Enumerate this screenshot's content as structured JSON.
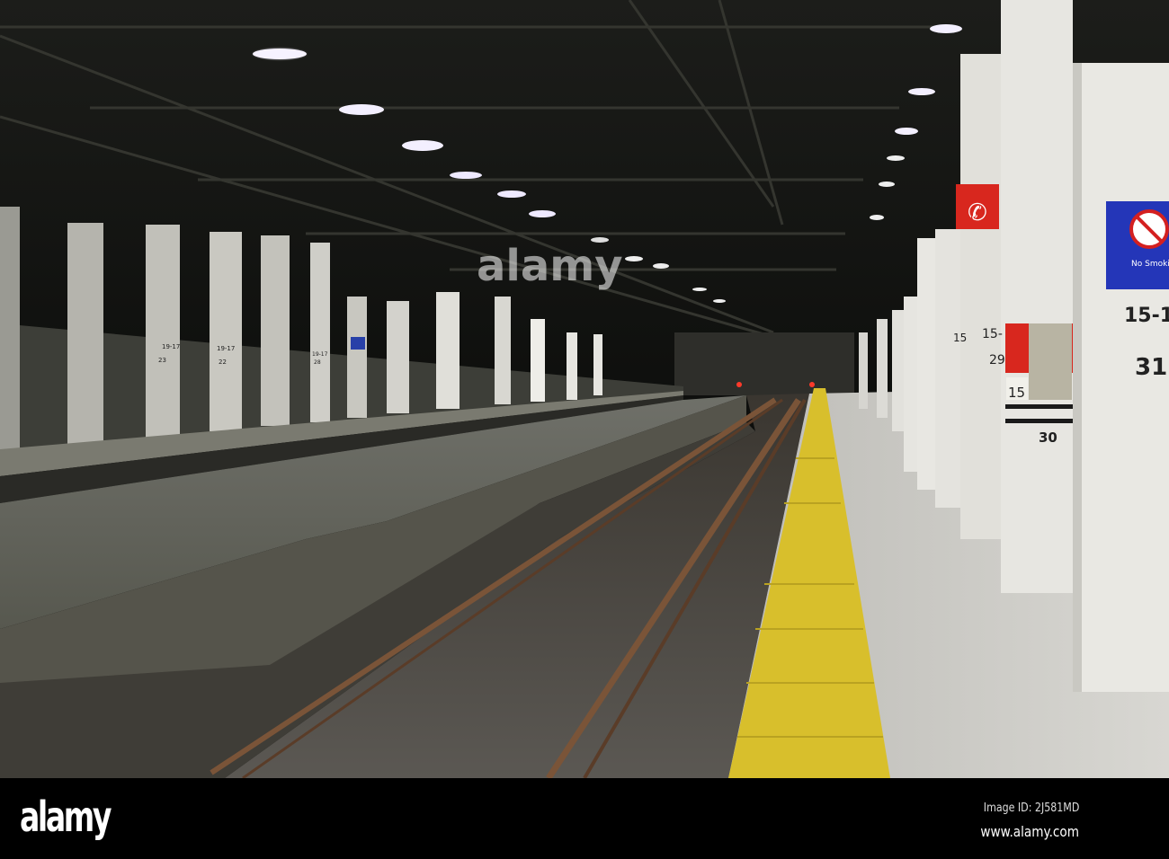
{
  "photo": {
    "signs": {
      "no_smoking": "No Smoking",
      "pillar_right_top": "15-1",
      "pillar_right_bottom": "31",
      "pillar_mid_top": "15-",
      "pillar_mid_bottom": "29",
      "pillar_red_label": "15",
      "pillar_red_bottom": "30",
      "pillar_far": "15",
      "left_pillars": [
        "19-17",
        "23",
        "19-17",
        "22",
        "19-17",
        "28"
      ]
    },
    "watermark": "alamy"
  },
  "footer": {
    "logo": "alamy",
    "image_id": "Image ID: 2J581MD",
    "url": "www.alamy.com"
  }
}
